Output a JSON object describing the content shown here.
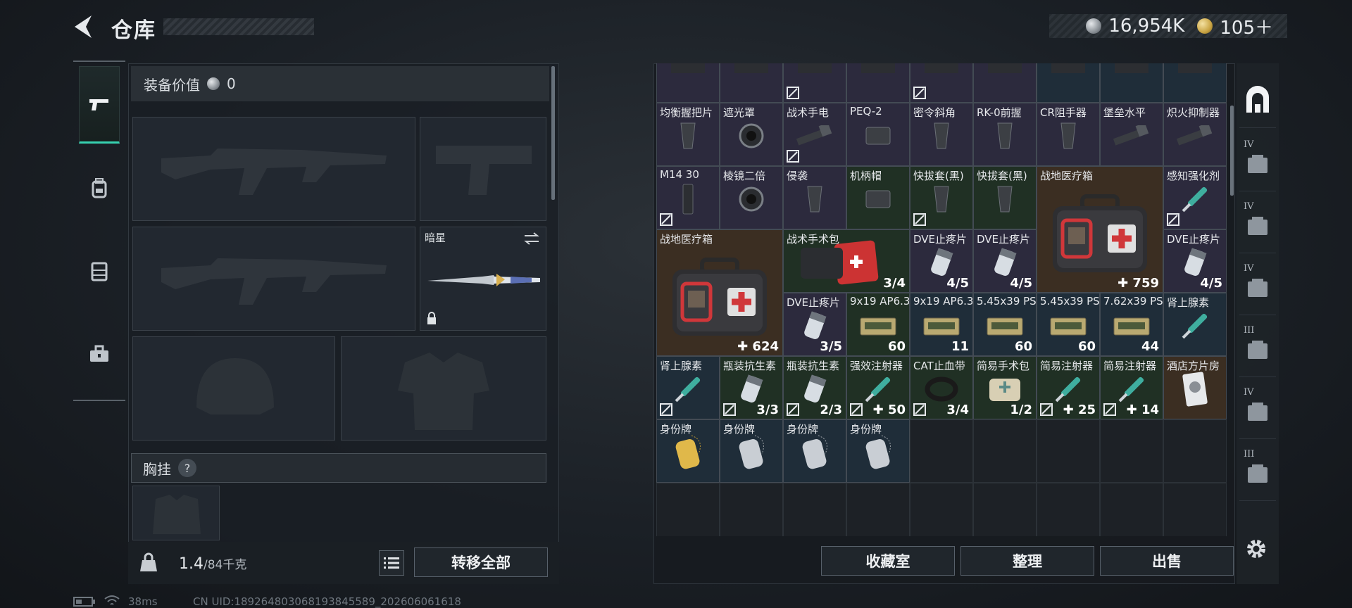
{
  "header": {
    "title": "仓库",
    "currency": [
      {
        "icon": "silver-coin-icon",
        "value": "16,954K"
      },
      {
        "icon": "gold-coin-icon",
        "value": "105＋"
      }
    ]
  },
  "left_rail": [
    "pistol-icon",
    "backpack-icon",
    "vest-icon",
    "toolbox-icon"
  ],
  "equipment": {
    "value_label": "装备价值",
    "value": "0",
    "melee_label": "暗星",
    "chest_label": "胸挂",
    "help": "?",
    "weight_value": "1.4",
    "weight_capacity": "/84千克",
    "transfer_all": "转移全部"
  },
  "storage": {
    "rows": [
      [
        {
          "col": 0,
          "name": "",
          "count": "",
          "rarity": "purple",
          "locked": false,
          "img": "part"
        },
        {
          "col": 1,
          "name": "",
          "count": "",
          "rarity": "purple",
          "locked": false,
          "img": "part"
        },
        {
          "col": 2,
          "name": "",
          "count": "",
          "rarity": "purple",
          "locked": true,
          "img": "part"
        },
        {
          "col": 3,
          "name": "",
          "count": "",
          "rarity": "purple",
          "locked": false,
          "img": "part"
        },
        {
          "col": 4,
          "name": "",
          "count": "",
          "rarity": "purple",
          "locked": true,
          "img": "part"
        },
        {
          "col": 5,
          "name": "",
          "count": "",
          "rarity": "purple",
          "locked": false,
          "img": "part"
        },
        {
          "col": 6,
          "name": "",
          "count": "",
          "rarity": "blue",
          "locked": false,
          "img": "part"
        },
        {
          "col": 7,
          "name": "",
          "count": "",
          "rarity": "blue",
          "locked": false,
          "img": "part"
        },
        {
          "col": 8,
          "name": "",
          "count": "",
          "rarity": "blue",
          "locked": false,
          "img": "part"
        }
      ],
      [
        {
          "col": 0,
          "name": "均衡握把片",
          "count": "",
          "rarity": "purple",
          "locked": false,
          "img": "grip"
        },
        {
          "col": 1,
          "name": "遮光罩",
          "count": "",
          "rarity": "purple",
          "locked": false,
          "img": "scope"
        },
        {
          "col": 2,
          "name": "战术手电",
          "count": "",
          "rarity": "purple",
          "locked": true,
          "img": "flashlight"
        },
        {
          "col": 3,
          "name": "PEQ-2",
          "count": "",
          "rarity": "purple",
          "locked": false,
          "img": "box"
        },
        {
          "col": 4,
          "name": "密令斜角",
          "count": "",
          "rarity": "purple",
          "locked": false,
          "img": "grip"
        },
        {
          "col": 5,
          "name": "RK-0前握",
          "count": "",
          "rarity": "purple",
          "locked": false,
          "img": "grip"
        },
        {
          "col": 6,
          "name": "CR阻手器",
          "count": "",
          "rarity": "purple",
          "locked": false,
          "img": "grip"
        },
        {
          "col": 7,
          "name": "堡垒水平",
          "count": "",
          "rarity": "purple",
          "locked": false,
          "img": "flashlight"
        },
        {
          "col": 8,
          "name": "炽火抑制器",
          "count": "",
          "rarity": "purple",
          "locked": false,
          "img": "flashlight"
        }
      ],
      [
        {
          "col": 0,
          "name": "M14 30",
          "count": "",
          "rarity": "purple",
          "locked": true,
          "img": "mag"
        },
        {
          "col": 1,
          "name": "棱镜二倍",
          "count": "",
          "rarity": "purple",
          "locked": false,
          "img": "scope"
        },
        {
          "col": 2,
          "name": "侵袭",
          "count": "",
          "rarity": "purple",
          "locked": false,
          "img": "grip"
        },
        {
          "col": 3,
          "name": "机柄帽",
          "count": "",
          "rarity": "green",
          "locked": false,
          "img": "box"
        },
        {
          "col": 4,
          "name": "快拔套(黑)",
          "count": "",
          "rarity": "green",
          "locked": true,
          "img": "grip"
        },
        {
          "col": 5,
          "name": "快拔套(黑)",
          "count": "",
          "rarity": "green",
          "locked": false,
          "img": "grip"
        },
        {
          "col": 8,
          "name": "感知强化剂",
          "count": "",
          "rarity": "purple",
          "locked": true,
          "img": "syringe"
        }
      ],
      [
        {
          "col": 2,
          "name": "战术手术包",
          "count": "3/4",
          "rarity": "green",
          "locked": false,
          "img": "redkit",
          "w": 2
        },
        {
          "col": 4,
          "name": "DVE止疼片",
          "count": "4/5",
          "rarity": "purple",
          "locked": false,
          "img": "pill"
        },
        {
          "col": 5,
          "name": "DVE止疼片",
          "count": "4/5",
          "rarity": "purple",
          "locked": false,
          "img": "pill"
        },
        {
          "col": 8,
          "name": "DVE止疼片",
          "count": "4/5",
          "rarity": "purple",
          "locked": false,
          "img": "pill"
        }
      ],
      [
        {
          "col": 2,
          "name": "DVE止疼片",
          "count": "3/5",
          "rarity": "purple",
          "locked": false,
          "img": "pill"
        },
        {
          "col": 3,
          "name": "9x19 AP6.3",
          "count": "60",
          "rarity": "green",
          "locked": false,
          "img": "ammo"
        },
        {
          "col": 4,
          "name": "9x19 AP6.3",
          "count": "11",
          "rarity": "blue",
          "locked": false,
          "img": "ammo"
        },
        {
          "col": 5,
          "name": "5.45x39 PS",
          "count": "60",
          "rarity": "blue",
          "locked": false,
          "img": "ammo"
        },
        {
          "col": 6,
          "name": "5.45x39 PS",
          "count": "60",
          "rarity": "blue",
          "locked": false,
          "img": "ammo"
        },
        {
          "col": 7,
          "name": "7.62x39 PS",
          "count": "44",
          "rarity": "blue",
          "locked": false,
          "img": "ammo"
        },
        {
          "col": 8,
          "name": "肾上腺素",
          "count": "",
          "rarity": "blue",
          "locked": false,
          "img": "syringe"
        }
      ],
      [
        {
          "col": 0,
          "name": "肾上腺素",
          "count": "",
          "rarity": "blue",
          "locked": true,
          "img": "syringe"
        },
        {
          "col": 1,
          "name": "瓶装抗生素",
          "count": "3/3",
          "rarity": "green",
          "locked": true,
          "img": "pill"
        },
        {
          "col": 2,
          "name": "瓶装抗生素",
          "count": "2/3",
          "rarity": "green",
          "locked": true,
          "img": "pill"
        },
        {
          "col": 3,
          "name": "强效注射器",
          "count": "+50",
          "rarity": "green",
          "locked": true,
          "img": "syringe"
        },
        {
          "col": 4,
          "name": "CAT止血带",
          "count": "3/4",
          "rarity": "green",
          "locked": true,
          "img": "tourniquet"
        },
        {
          "col": 5,
          "name": "简易手术包",
          "count": "1/2",
          "rarity": "green",
          "locked": false,
          "img": "pouch"
        },
        {
          "col": 6,
          "name": "简易注射器",
          "count": "+25",
          "rarity": "green",
          "locked": true,
          "img": "syringe"
        },
        {
          "col": 7,
          "name": "简易注射器",
          "count": "+14",
          "rarity": "green",
          "locked": true,
          "img": "syringe"
        },
        {
          "col": 8,
          "name": "酒店方片房",
          "count": "",
          "rarity": "gold",
          "locked": false,
          "img": "card"
        }
      ],
      [
        {
          "col": 0,
          "name": "身份牌",
          "count": "",
          "rarity": "blue",
          "locked": false,
          "img": "tag-gold"
        },
        {
          "col": 1,
          "name": "身份牌",
          "count": "",
          "rarity": "blue",
          "locked": false,
          "img": "tag"
        },
        {
          "col": 2,
          "name": "身份牌",
          "count": "",
          "rarity": "blue",
          "locked": false,
          "img": "tag"
        },
        {
          "col": 3,
          "name": "身份牌",
          "count": "",
          "rarity": "blue",
          "locked": false,
          "img": "tag"
        }
      ]
    ],
    "big_items": [
      {
        "name": "战地医疗箱",
        "count": "+759",
        "col": 6,
        "row": 2,
        "w": 2,
        "h": 2,
        "rarity": "gold"
      },
      {
        "name": "战地医疗箱",
        "count": "+624",
        "col": 0,
        "row": 3,
        "w": 2,
        "h": 2,
        "rarity": "gold"
      }
    ]
  },
  "storage_buttons": {
    "collection": "收藏室",
    "sort": "整理",
    "sell": "出售"
  },
  "categories": [
    "all-storage-icon",
    "tier-4-case-icon",
    "tier-4-case-icon",
    "tier-4-case-icon",
    "tier-3-case-icon",
    "tier-4-case-icon",
    "tier-3-case-icon"
  ],
  "category_badges": [
    "IV",
    "IV",
    "IV",
    "III",
    "IV",
    "III"
  ],
  "status_bar": {
    "ping": "38ms",
    "uid": "CN UID:18926480306819384558‍9_202606061618"
  },
  "colors": {
    "accent": "#37d1b0",
    "purple_rarity": "#2c2a3d",
    "green_rarity": "#203024",
    "blue_rarity": "#1f2d39",
    "gold_rarity": "#3b2e22"
  }
}
